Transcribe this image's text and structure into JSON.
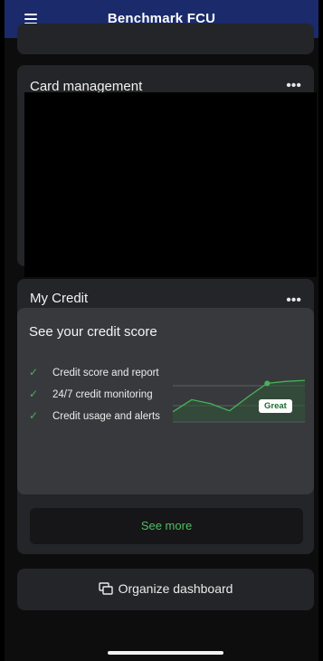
{
  "app": {
    "title": "Benchmark FCU"
  },
  "card_management": {
    "title": "Card management",
    "menu_label": "•••"
  },
  "my_credit": {
    "title": "My Credit",
    "menu_label": "•••",
    "heading": "See your credit score",
    "features": [
      "Credit score and report",
      "24/7 credit monitoring",
      "Credit usage and alerts"
    ],
    "badge": "Great",
    "see_more": "See more"
  },
  "organize": {
    "label": "Organize dashboard",
    "icon": "cards-stack-icon"
  },
  "colors": {
    "topbar": "#1a2a6a",
    "accent_green": "#47b35a",
    "card": "#242528",
    "panel": "#38393d"
  },
  "chart_data": {
    "type": "line",
    "x": [
      0,
      1,
      2,
      3,
      4,
      5,
      6,
      7
    ],
    "values": [
      1,
      2.2,
      1.8,
      1.1,
      2.5,
      3.8,
      4.0,
      4.1
    ],
    "ylim": [
      0,
      5
    ],
    "highlight_index": 5,
    "title": "",
    "xlabel": "",
    "ylabel": ""
  }
}
